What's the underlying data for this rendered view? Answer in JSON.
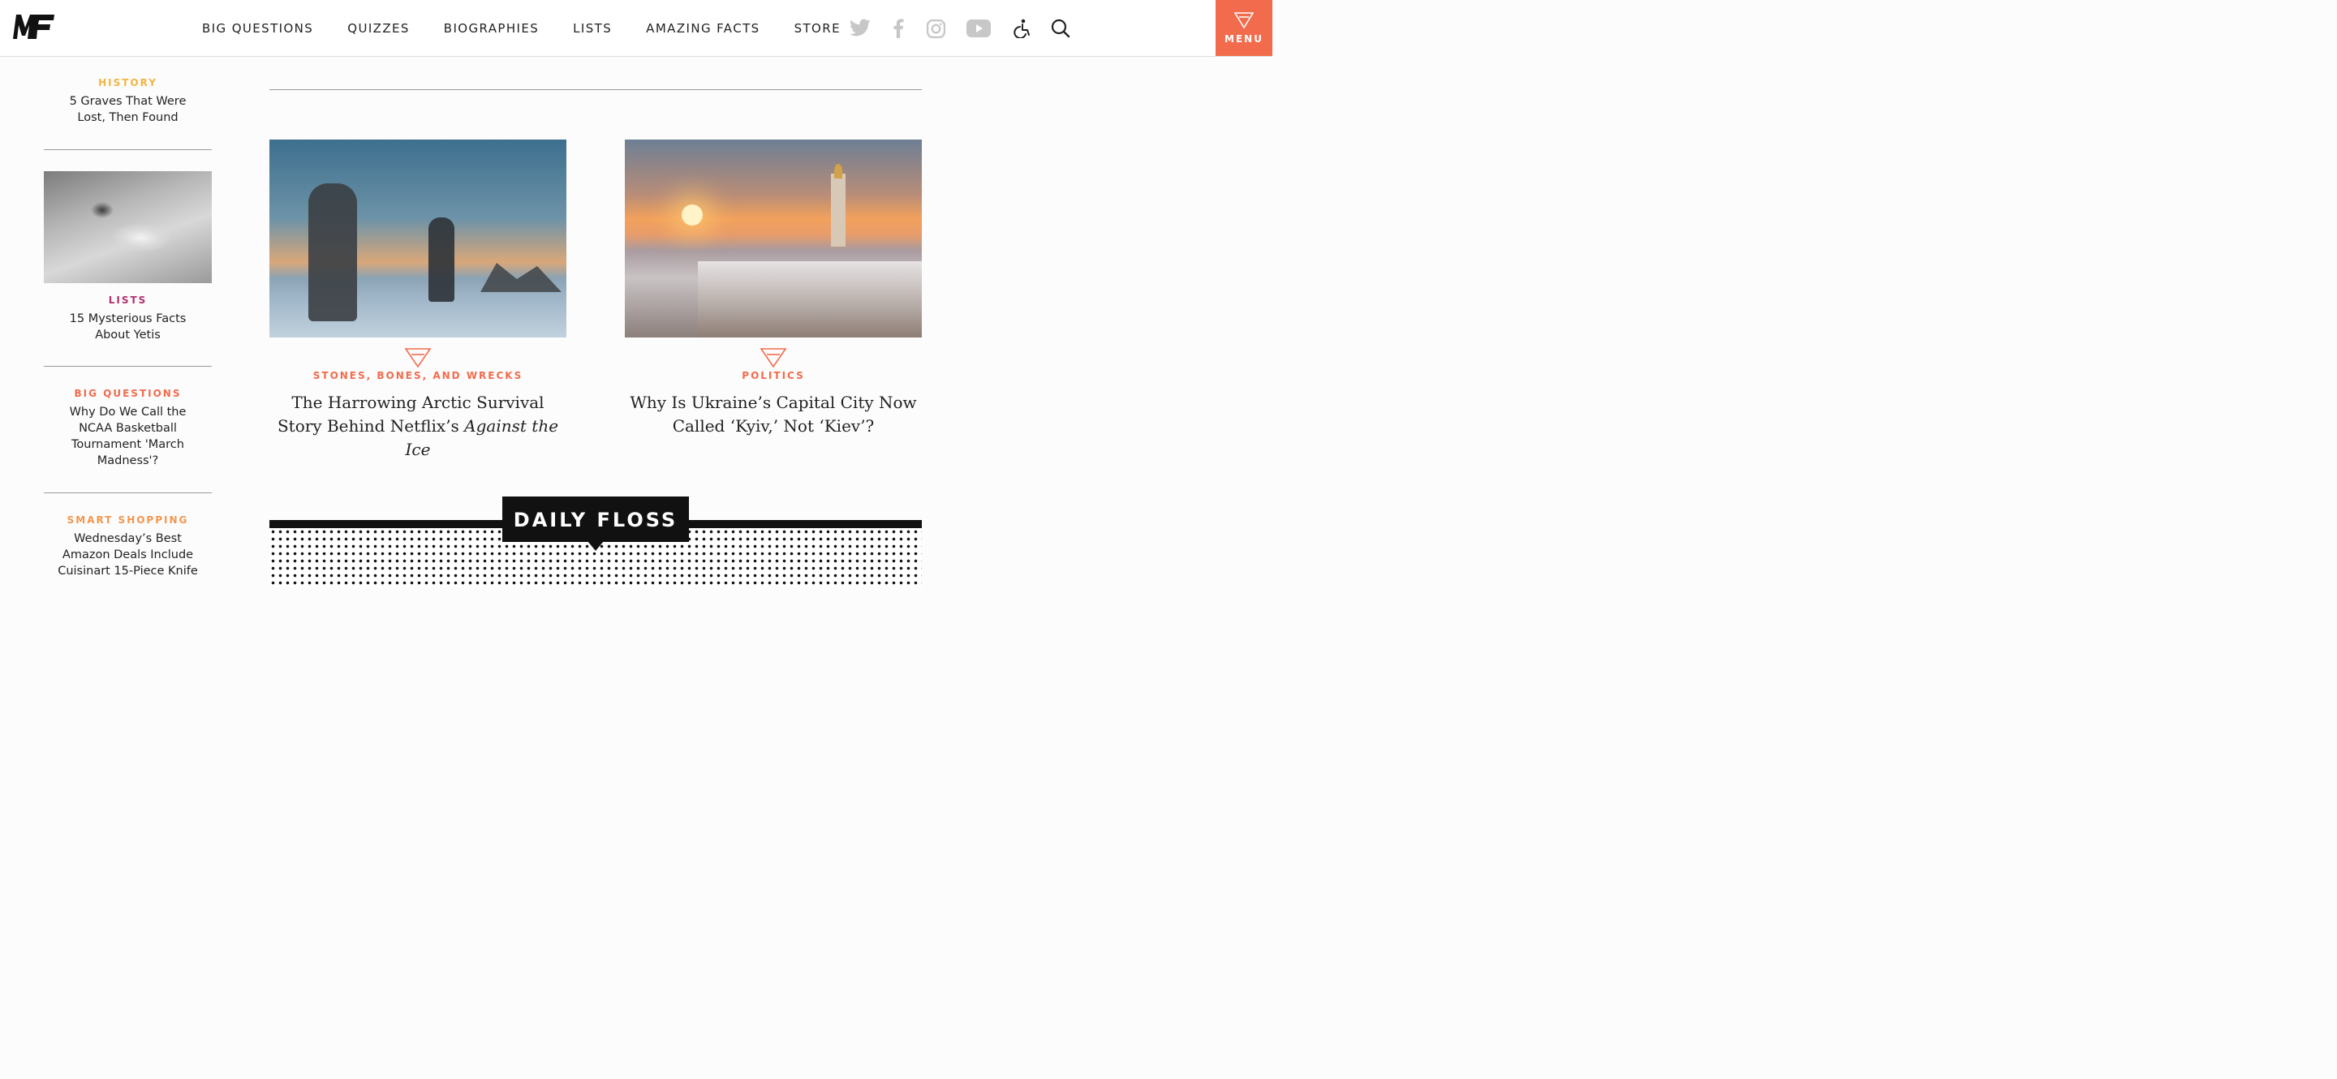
{
  "header": {
    "logo_text": "MF",
    "nav": [
      "BIG QUESTIONS",
      "QUIZZES",
      "BIOGRAPHIES",
      "LISTS",
      "AMAZING FACTS",
      "STORE"
    ],
    "icons": [
      "twitter-icon",
      "facebook-icon",
      "instagram-icon",
      "youtube-icon",
      "accessibility-icon",
      "search-icon"
    ],
    "menu_label": "MENU",
    "accent_color": "#f26b4c"
  },
  "sidebar": {
    "items": [
      {
        "category": "HISTORY",
        "category_color": "#f2b441",
        "title": "5 Graves That Were Lost, Then Found"
      },
      {
        "category": "LISTS",
        "category_color": "#b0306e",
        "title": "15 Mysterious Facts About Yetis"
      },
      {
        "category": "BIG QUESTIONS",
        "category_color": "#f26b4c",
        "title": "Why Do We Call the NCAA Basketball Tournament 'March Madness'?"
      },
      {
        "category": "SMART SHOPPING",
        "category_color": "#f2954c",
        "title": "Wednesday’s Best Amazon Deals Include Cuisinart 15-Piece Knife"
      }
    ]
  },
  "main": {
    "cards": [
      {
        "category": "STONES, BONES, AND WRECKS",
        "title_plain": "The Harrowing Arctic Survival Story Behind Netflix’s ",
        "title_italic": "Against the Ice"
      },
      {
        "category": "POLITICS",
        "title_plain": "Why Is Ukraine’s Capital City Now Called ‘Kyiv,’ Not ‘Kiev’?",
        "title_italic": ""
      }
    ],
    "daily_floss_label": "DAILY FLOSS"
  }
}
